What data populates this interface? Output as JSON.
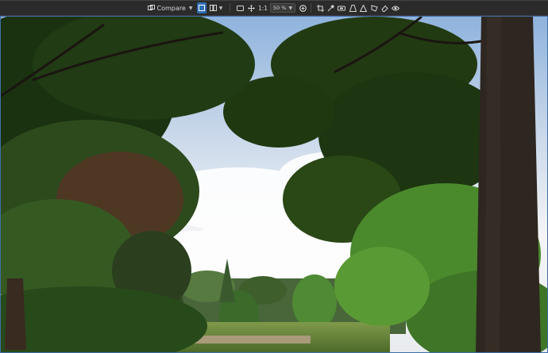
{
  "toolbar": {
    "compare_label": "Compare",
    "one_to_one_label": "1:1",
    "zoom_value": "50 %"
  },
  "colors": {
    "toolbar_bg": "#2b2b2b",
    "active_button": "#2f6db3",
    "frame_border": "#3f6fa8",
    "icon": "#d6d6d6"
  },
  "icons": [
    "compare-icon",
    "single-view-icon",
    "split-view-icon",
    "frame-icon",
    "move-icon",
    "zoom-in-icon",
    "crop-icon",
    "color-picker-icon",
    "level-icon",
    "perspective-icon",
    "shape-icon",
    "polygon-icon",
    "eraser-icon",
    "eye-icon"
  ]
}
